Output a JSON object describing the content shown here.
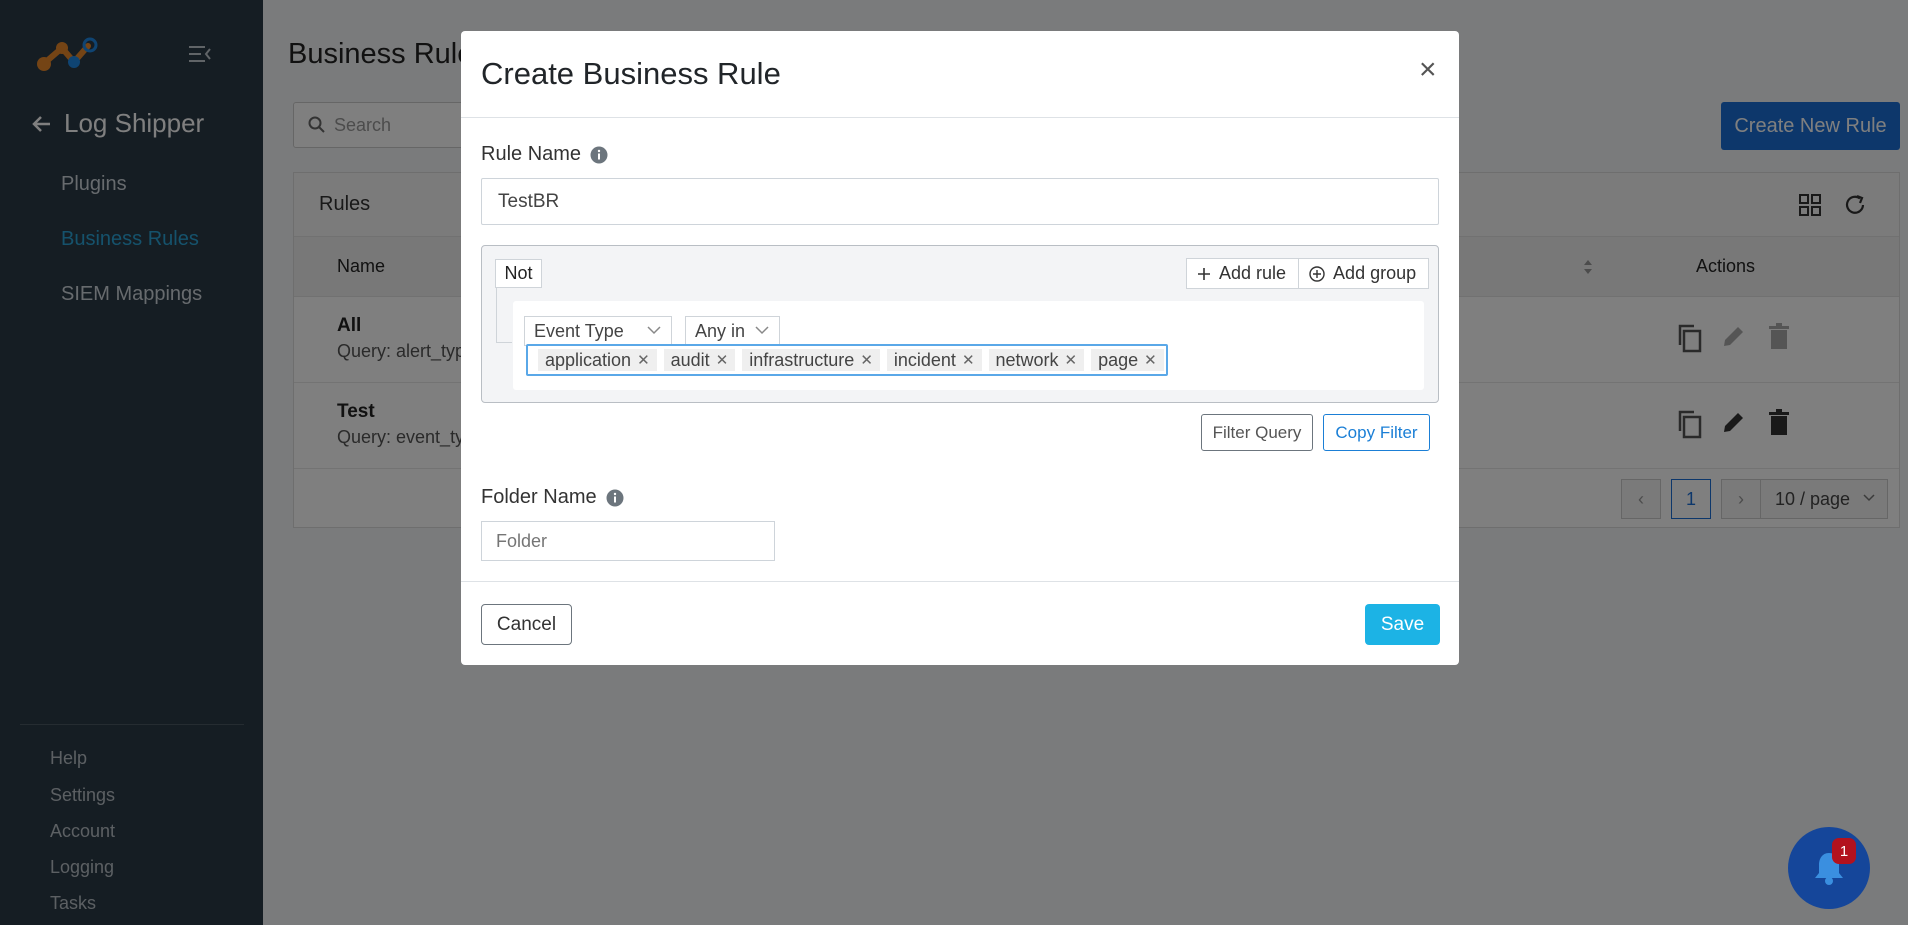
{
  "sidebar": {
    "app_title": "Log Shipper",
    "nav": [
      "Plugins",
      "Business Rules",
      "SIEM Mappings"
    ],
    "footer": [
      "Help",
      "Settings",
      "Account",
      "Logging",
      "Tasks"
    ]
  },
  "main": {
    "page_title": "Business Rules",
    "search_placeholder": "Search",
    "create_button": "Create New Rule",
    "card_title": "Rules",
    "columns": {
      "name": "Name",
      "actions": "Actions"
    },
    "rows": [
      {
        "name": "All",
        "query": "Query: alert_type"
      },
      {
        "name": "Test",
        "query": "Query: event_typ"
      }
    ],
    "pagination": {
      "current_page": "1",
      "page_size": "10 / page"
    }
  },
  "notifications": {
    "count": "1"
  },
  "modal": {
    "title": "Create Business Rule",
    "close": "×",
    "rule_name_label": "Rule Name",
    "rule_name_value": "TestBR",
    "query_builder": {
      "not_label": "Not",
      "add_rule": "Add rule",
      "add_group": "Add group",
      "field": "Event Type",
      "operator": "Any in",
      "values": [
        "application",
        "audit",
        "infrastructure",
        "incident",
        "network",
        "page"
      ]
    },
    "filter_query_button": "Filter Query",
    "copy_filter_button": "Copy Filter",
    "folder_label": "Folder Name",
    "folder_placeholder": "Folder",
    "cancel_button": "Cancel",
    "save_button": "Save"
  }
}
